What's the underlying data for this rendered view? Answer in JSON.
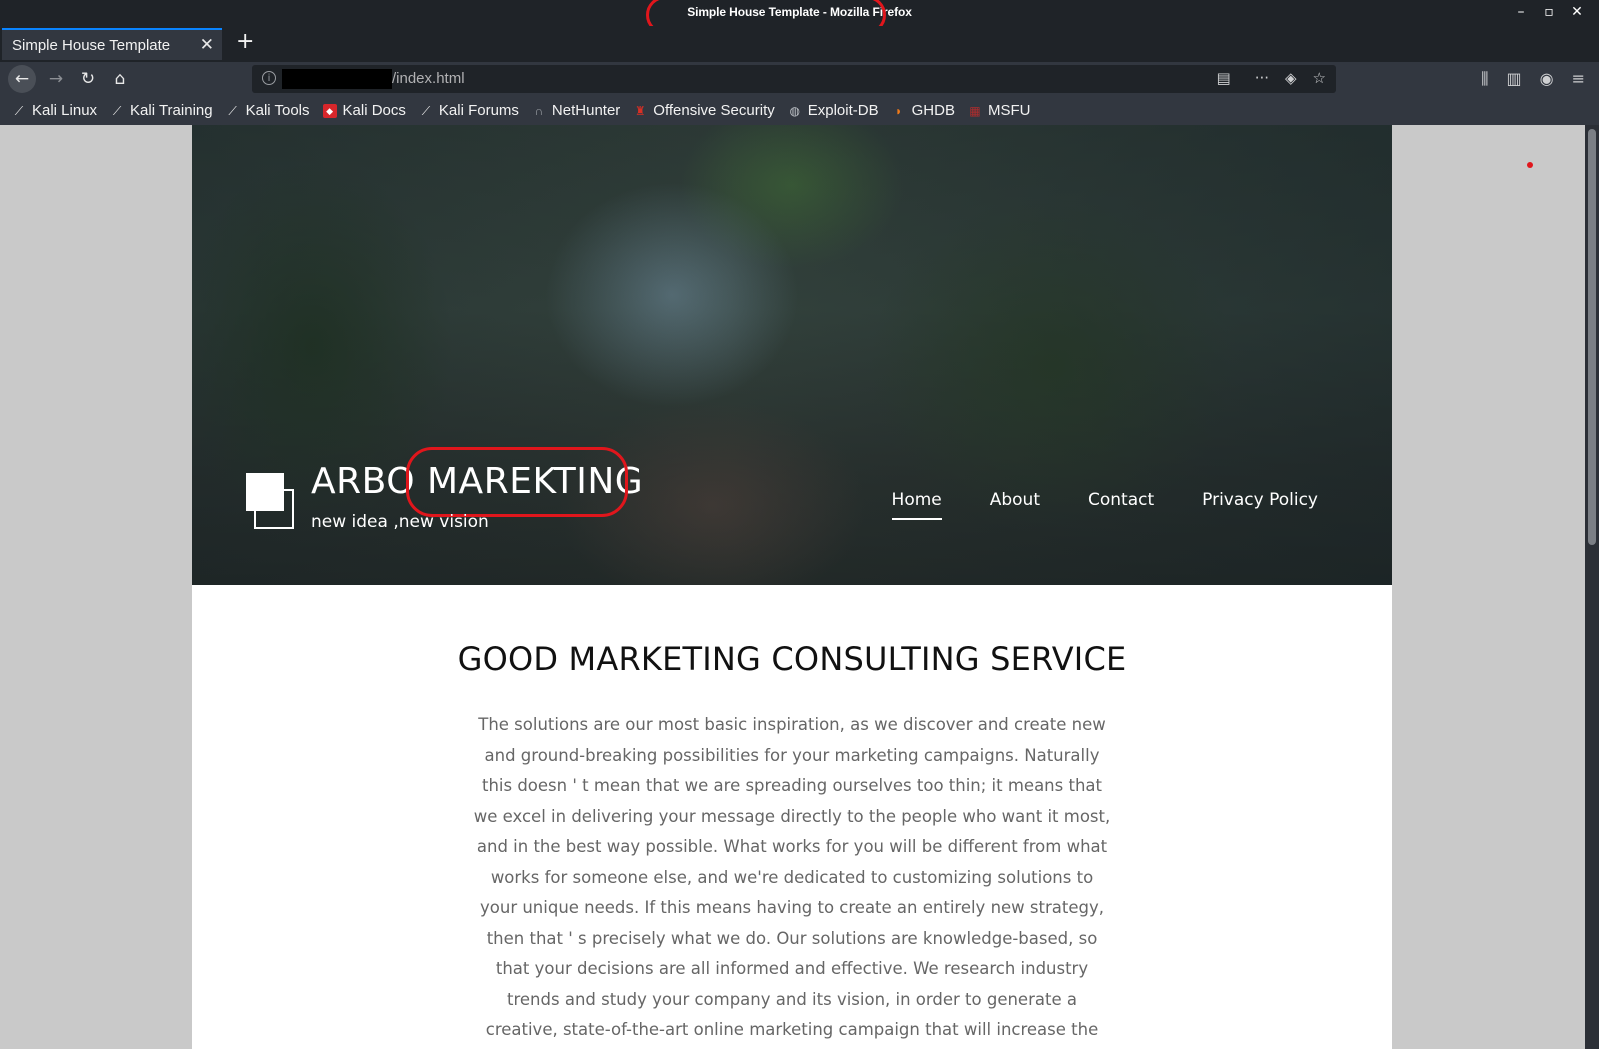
{
  "window": {
    "title": "Simple House Template - Mozilla Firefox"
  },
  "tab": {
    "title": "Simple House Template",
    "close": "✕",
    "new_tab": "+"
  },
  "nav": {
    "url_suffix": "/index.html"
  },
  "icons": {
    "back": "back-arrow-icon",
    "forward": "forward-arrow-icon",
    "reload": "reload-icon",
    "home": "home-icon",
    "reader": "reader-view-icon",
    "more": "more-icon",
    "pocket": "pocket-icon",
    "star": "bookmark-star-icon",
    "library": "library-icon",
    "sidebar": "sidebar-icon",
    "account": "account-icon",
    "menu": "hamburger-menu-icon"
  },
  "bookmarks": [
    {
      "label": "Kali Linux",
      "icon": "kali-dragon-icon"
    },
    {
      "label": "Kali Training",
      "icon": "kali-dragon-icon"
    },
    {
      "label": "Kali Tools",
      "icon": "kali-dragon-icon"
    },
    {
      "label": "Kali Docs",
      "icon": "kali-docs-icon"
    },
    {
      "label": "Kali Forums",
      "icon": "kali-dragon-icon"
    },
    {
      "label": "NetHunter",
      "icon": "nethunter-icon"
    },
    {
      "label": "Offensive Security",
      "icon": "offsec-icon"
    },
    {
      "label": "Exploit-DB",
      "icon": "exploit-db-icon"
    },
    {
      "label": "GHDB",
      "icon": "ghdb-icon"
    },
    {
      "label": "MSFU",
      "icon": "msfu-icon"
    }
  ],
  "site": {
    "title_part1": "ARBO",
    "title_part2": "MAREKTING",
    "tagline": "new idea ,new vision",
    "menu": [
      {
        "label": "Home",
        "active": true
      },
      {
        "label": "About",
        "active": false
      },
      {
        "label": "Contact",
        "active": false
      },
      {
        "label": "Privacy Policy",
        "active": false
      }
    ],
    "heading": "GOOD MARKETING CONSULTING SERVICE",
    "body": "The solutions are our most basic inspiration, as we discover and create new and ground-breaking possibilities for your marketing campaigns. Naturally this doesn ' t mean that we are spreading ourselves too thin; it means that we excel in delivering your message directly to the people who want it most, and in the best way possible. What works for you will be different from what works for someone else, and we're dedicated to customizing solutions to your unique needs. If this means having to create an entirely new strategy, then that ' s precisely what we do. Our solutions are knowledge-based, so that your decisions are all informed and effective. We research industry trends and study your company and its vision, in order to generate a creative, state-of-the-art online marketing campaign that will increase the return on your advertising campaign"
  },
  "colors": {
    "annotation": "#e0161c",
    "chrome": "#1f2328",
    "toolbar": "#323740",
    "accent": "#0a84ff"
  }
}
